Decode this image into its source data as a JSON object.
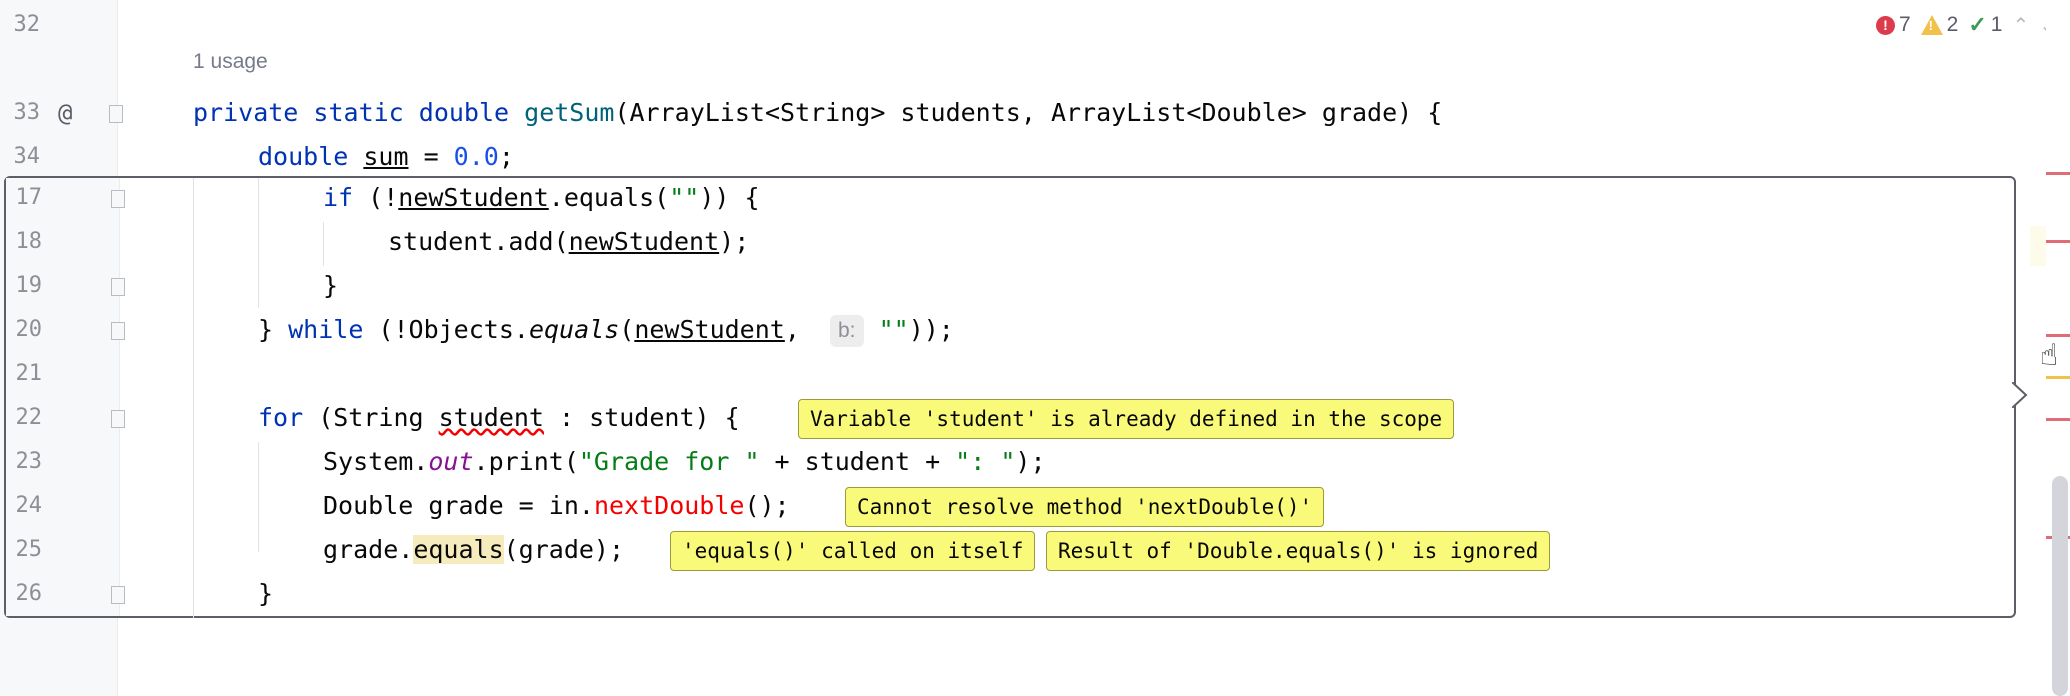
{
  "editor": {
    "usage_hint": "1 usage",
    "line_numbers": {
      "l32": "32",
      "l33": "33",
      "l34": "34",
      "p17": "17",
      "p18": "18",
      "p19": "19",
      "p20": "20",
      "p21": "21",
      "p22": "22",
      "p23": "23",
      "p24": "24",
      "p25": "25",
      "p26": "26"
    },
    "override_marker": "@",
    "line33": {
      "t1": "private static double ",
      "t2": "getSum",
      "t3": "(ArrayList<String> students, ArrayList<Double> grade) {"
    },
    "line34": {
      "t1": "double ",
      "t2": "sum",
      "t3": " = ",
      "t4": "0.0",
      "t5": ";"
    }
  },
  "peek": {
    "line17": {
      "t1": "if ",
      "t2": "(!",
      "t3": "newStudent",
      "t4": ".equals(",
      "t5": "\"\"",
      "t6": ")) {"
    },
    "line18": {
      "t1": "student.add(",
      "t2": "newStudent",
      "t3": ");"
    },
    "line19": {
      "t1": "}"
    },
    "line20": {
      "t1": "} ",
      "t2": "while",
      "t3": " (!Objects.",
      "t4": "equals",
      "t5": "(",
      "t6": "newStudent",
      "t7": ",  ",
      "hint": "b:",
      "t8": " ",
      "t9": "\"\"",
      "t10": "));"
    },
    "line22": {
      "t1": "for",
      "t2": " (String ",
      "t3": "student",
      "t4": " : student) {"
    },
    "line23": {
      "t1": "System.",
      "t2": "out",
      "t3": ".print(",
      "t4": "\"Grade for \"",
      "t5": " + student + ",
      "t6": "\": \"",
      "t7": ");"
    },
    "line24": {
      "t1": "Double grade = in.",
      "t2": "nextDouble",
      "t3": "();"
    },
    "line25": {
      "t1": "grade.",
      "t2": "equals",
      "t3": "(grade);"
    },
    "line26": {
      "t1": "}"
    }
  },
  "inspections": {
    "student_defined": "Variable 'student' is already defined in the scope",
    "cannot_resolve": "Cannot resolve method 'nextDouble()'",
    "equals_itself": "'equals()' called on itself",
    "result_ignored": "Result of 'Double.equals()' is ignored"
  },
  "status_widget": {
    "errors": "7",
    "warnings": "2",
    "weak_warnings": "1"
  },
  "colors": {
    "keyword": "#0033b3",
    "method": "#00627a",
    "number": "#1750eb",
    "string": "#067d17",
    "error": "#f50000",
    "inspection_bg": "#fafa7a"
  }
}
